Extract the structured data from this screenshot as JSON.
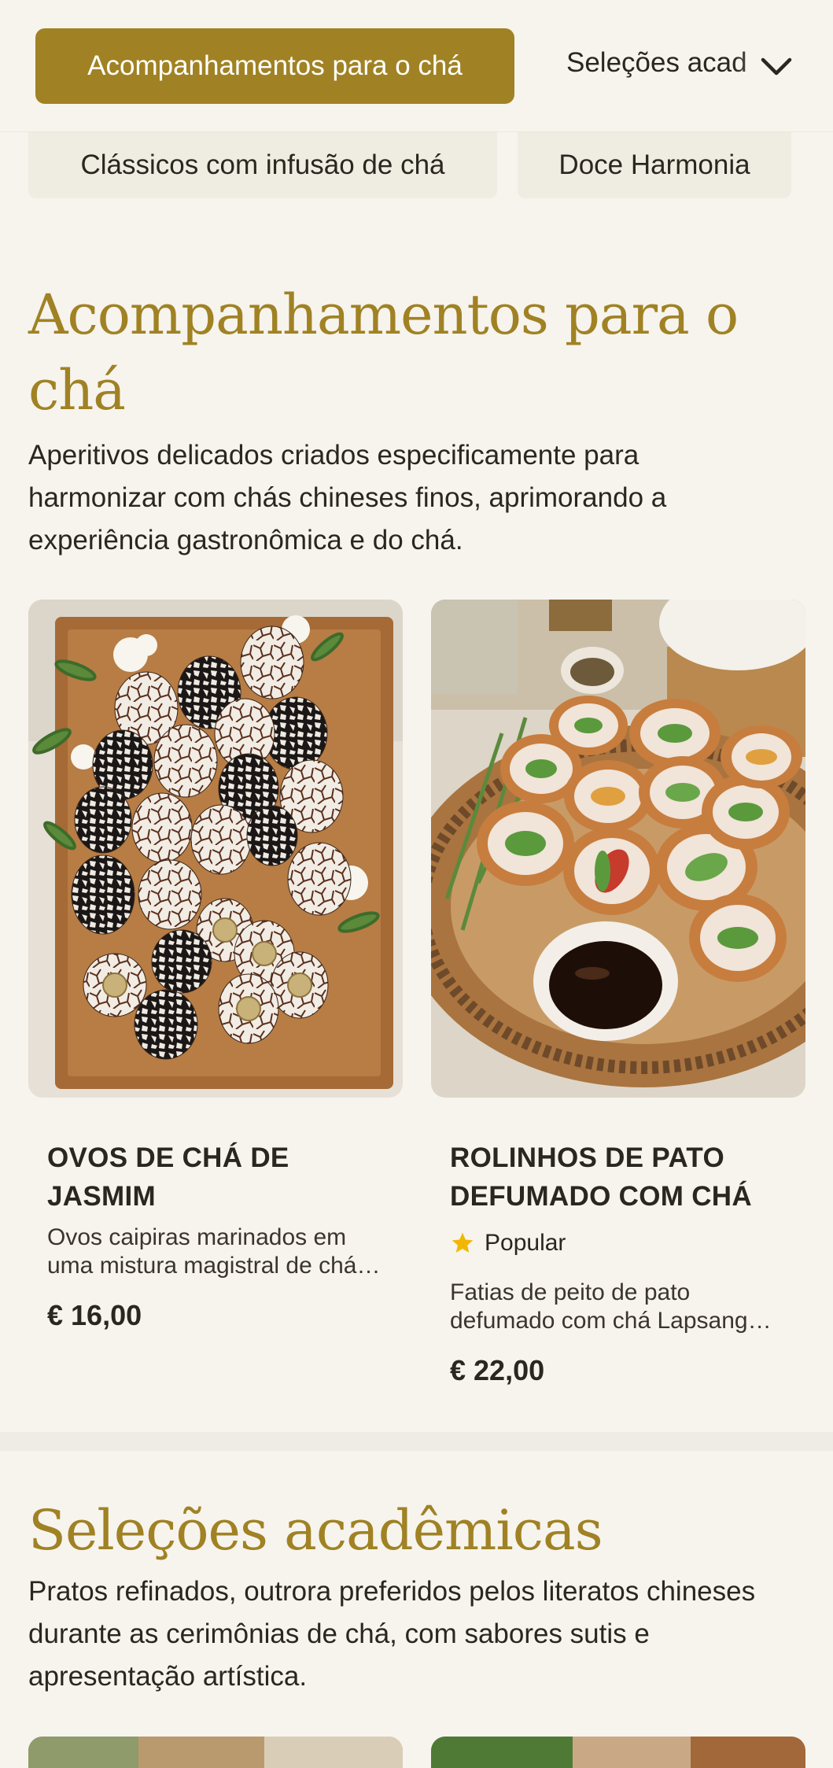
{
  "nav": {
    "active_category": "Acompanhamentos para o chá",
    "next_category": "Seleções acadêmicas",
    "subcategories": [
      "Clássicos com infusão de chá",
      "Doce Harmonia"
    ]
  },
  "section1": {
    "title": "Acompanhamentos para o chá",
    "description": "Aperitivos delicados criados especificamente para harmonizar com chás chineses finos, aprimorando a experiência gastronômica e do chá.",
    "items": [
      {
        "name": "OVOS DE CHÁ DE JASMIM",
        "description": "Ovos caipiras marinados em uma mistura magistral de chá de jasmim e especiarias.",
        "price": "€ 16,00",
        "image_icon": "tea-eggs-image"
      },
      {
        "name": "ROLINHOS DE PATO DEFUMADO COM CHÁ",
        "badge": "Popular",
        "description": "Fatias de peito de pato defumado com chá Lapsang Souchong enroladas com legumes frescos.",
        "price": "€ 22,00",
        "image_icon": "duck-rolls-image"
      }
    ]
  },
  "section2": {
    "title": "Seleções acadêmicas",
    "description": "Pratos refinados, outrora preferidos pelos literatos chineses durante as cerimônias de chá, com sabores sutis e apresentação artística."
  },
  "colors": {
    "accent": "#a08224",
    "background": "#f7f4ee",
    "chip_background": "#efece2",
    "star": "#f2b705"
  }
}
